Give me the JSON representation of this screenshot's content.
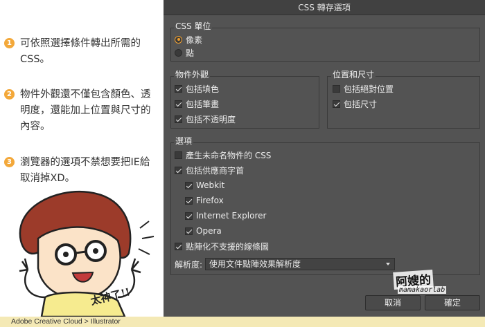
{
  "notes": [
    {
      "num": "1",
      "text": "可依照選擇條件轉出所需的CSS。"
    },
    {
      "num": "2",
      "text": "物件外觀還不僅包含顏色、透明度，還能加上位置與尺寸的內容。"
    },
    {
      "num": "3",
      "text": "瀏覽器的選項不禁想要把IE給取消掉XD。"
    }
  ],
  "cartoon": {
    "shout": "太神了!!"
  },
  "caption": "Adobe Creative Cloud > Illustrator",
  "dialog": {
    "title": "CSS 轉存選項",
    "css_units": {
      "title": "CSS 單位",
      "options": [
        {
          "label": "像素",
          "checked": true
        },
        {
          "label": "點",
          "checked": false
        }
      ]
    },
    "appearance": {
      "title": "物件外觀",
      "items": [
        {
          "label": "包括填色",
          "checked": true
        },
        {
          "label": "包括筆畫",
          "checked": true
        },
        {
          "label": "包括不透明度",
          "checked": true
        }
      ]
    },
    "position_size": {
      "title": "位置和尺寸",
      "items": [
        {
          "label": "包括絕對位置",
          "checked": false
        },
        {
          "label": "包括尺寸",
          "checked": true
        }
      ]
    },
    "options": {
      "title": "選項",
      "unnamed": {
        "label": "產生未命名物件的 CSS",
        "checked": false
      },
      "vendor": {
        "label": "包括供應商字首",
        "checked": true
      },
      "vendors": [
        {
          "label": "Webkit",
          "checked": true
        },
        {
          "label": "Firefox",
          "checked": true
        },
        {
          "label": "Internet Explorer",
          "checked": true
        },
        {
          "label": "Opera",
          "checked": true
        }
      ],
      "rasterize": {
        "label": "點陣化不支援的線條圖",
        "checked": true
      },
      "resolution_label": "解析度:",
      "resolution_value": "使用文件點陣效果解析度"
    },
    "cancel_label": "取消",
    "ok_label": "確定"
  },
  "signature": {
    "line1": "阿嫂的",
    "line2": "mamakaorlab"
  },
  "colors": {
    "accent": "#f3a83a",
    "dialog_bg": "#535353",
    "caption_bg": "#f4e9b5"
  }
}
